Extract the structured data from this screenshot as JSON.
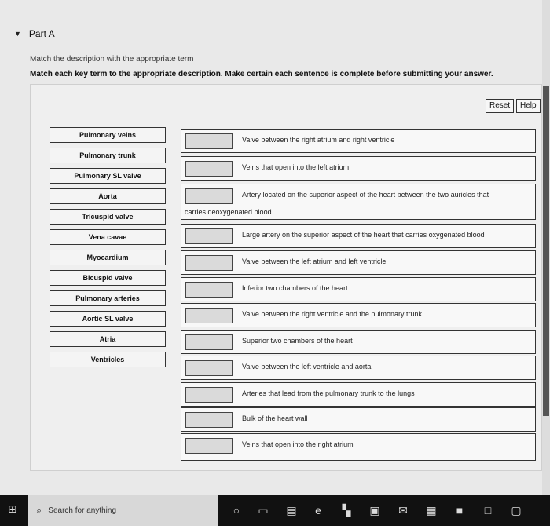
{
  "part_label": "Part A",
  "instructions": {
    "line1": "Match the description with the appropriate term",
    "line2": "Match each key term to the appropriate description. Make certain each sentence is complete before submitting your answer."
  },
  "buttons": {
    "reset": "Reset",
    "help": "Help"
  },
  "terms": [
    "Pulmonary veins",
    "Pulmonary trunk",
    "Pulmonary SL valve",
    "Aorta",
    "Tricuspid valve",
    "Vena cavae",
    "Myocardium",
    "Bicuspid valve",
    "Pulmonary arteries",
    "Aortic SL valve",
    "Atria",
    "Ventricles"
  ],
  "descriptions": [
    {
      "text": "Valve between the right atrium and right ventricle"
    },
    {
      "text": "Veins that open into the left atrium"
    },
    {
      "text": "Artery located on the superior aspect of the heart between the two auricles that",
      "text2": "carries deoxygenated blood"
    },
    {
      "text": "Large artery on the superior aspect of the heart that carries oxygenated blood"
    },
    {
      "text": "Valve between the left atrium and left ventricle"
    },
    {
      "text": "Inferior two chambers of the heart"
    },
    {
      "text": "Valve between the right ventricle and the pulmonary trunk"
    },
    {
      "text": "Superior two chambers of the heart"
    },
    {
      "text": "Valve between the left ventricle and aorta"
    },
    {
      "text": "Arteries that lead from the pulmonary trunk to the lungs"
    },
    {
      "text": "Bulk of the heart wall"
    },
    {
      "text": "Veins that open into the right atrium"
    }
  ],
  "taskbar": {
    "search_placeholder": "Search for anything",
    "icons": [
      "windows-icon",
      "search-icon",
      "cortana-icon",
      "task-view-icon",
      "app-icon",
      "edge-icon",
      "app-icon",
      "store-icon",
      "mail-icon",
      "app-icon",
      "app-icon",
      "app-icon"
    ]
  }
}
